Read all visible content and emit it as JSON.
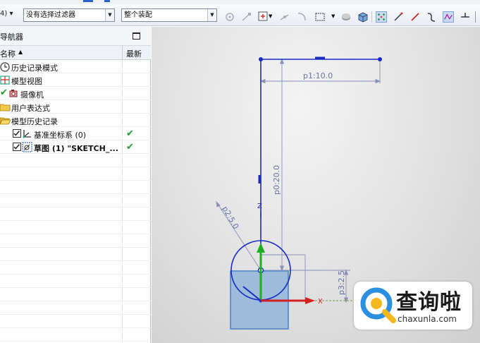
{
  "toolbar": {
    "left_fragment": "4) ▾",
    "filter_combo": "没有选择过滤器",
    "assembly_combo": "整个装配"
  },
  "navigator": {
    "title": "导航器",
    "col_name": "名称",
    "col_latest": "最新",
    "items": [
      {
        "label": "历史记录模式",
        "icon": "clock-icon"
      },
      {
        "label": "模型视图",
        "icon": "views-icon"
      },
      {
        "label": "摄像机",
        "icon": "camera-icon"
      },
      {
        "label": "用户表达式",
        "icon": "folder-icon"
      },
      {
        "label": "模型历史记录",
        "icon": "folder-open-icon"
      },
      {
        "label": "基准坐标系 (0)",
        "icon": "datum-csys-icon",
        "latest": "✔"
      },
      {
        "label": "草图 (1) \"SKETCH_...",
        "icon": "sketch-icon",
        "latest": "✔"
      }
    ]
  },
  "sketch": {
    "dim_p1": "p1:10.0",
    "dim_p0": "p0:20.0",
    "dim_p2": "p2:5.0",
    "dim_p3": "p3:2.5",
    "axis_z": "Z",
    "axis_x": "X"
  },
  "watermark": {
    "name": "查询啦",
    "url": "chaxunla.com"
  },
  "colors": {
    "sketch_line": "#1a2bc4",
    "dimension": "#8a90b8",
    "axis_y": "#1fae1f",
    "axis_x": "#d42020",
    "solid_face": "#9dbcdc",
    "check": "#1e9b2a"
  }
}
